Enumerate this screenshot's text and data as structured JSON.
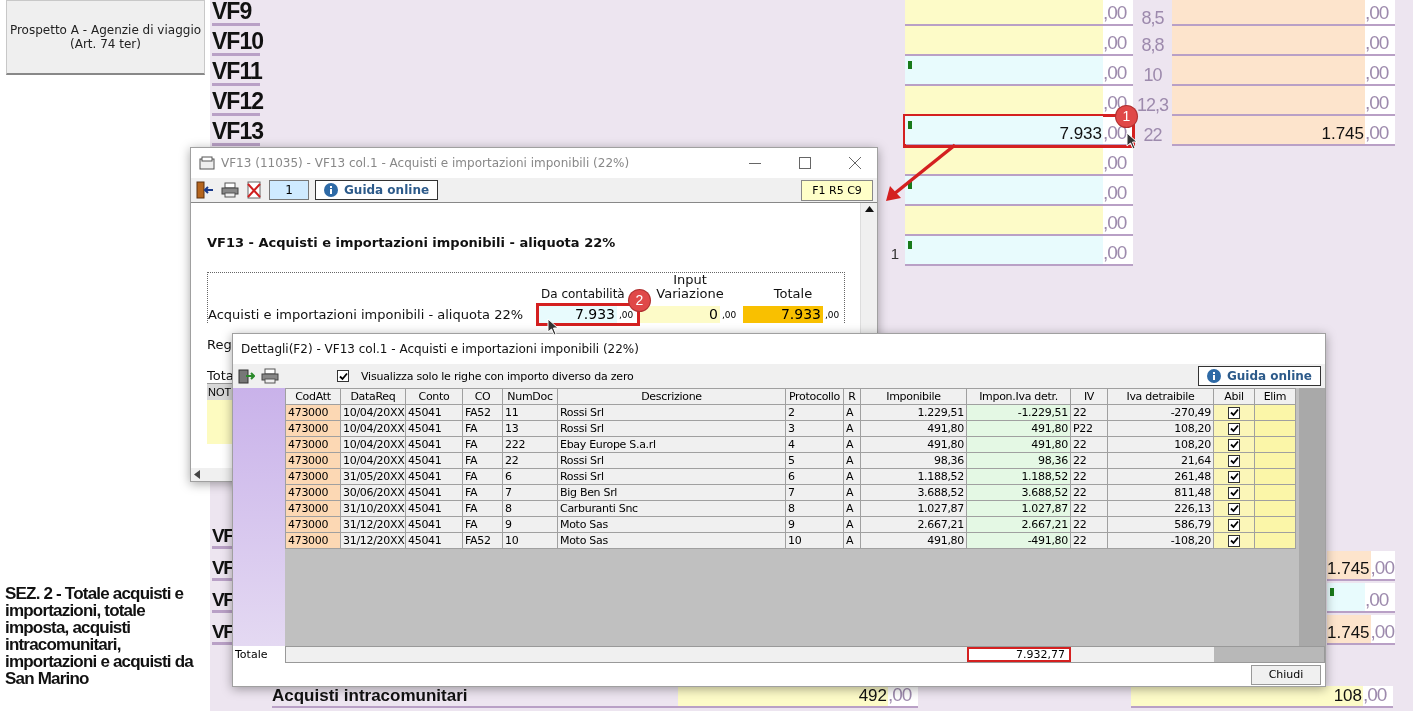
{
  "side_button": {
    "lines": [
      "Prospetto A - Agenzie di viaggio",
      "(Art. 74 ter)"
    ]
  },
  "section_title": "SEZ. 2 - Totale acquisti e importazioni, totale imposta, acquisti intracomunitari, importazioni e acquisti da San Marino",
  "top_rows": [
    {
      "label": "VF9",
      "base": {
        "kind": "input",
        "decimals": ",00"
      },
      "rate": "8,5",
      "tax": {
        "kind": "tax",
        "decimals": ",00"
      }
    },
    {
      "label": "VF10",
      "base": {
        "kind": "input",
        "decimals": ",00"
      },
      "rate": "8,8",
      "tax": {
        "kind": "tax",
        "decimals": ",00"
      }
    },
    {
      "label": "VF11",
      "base": {
        "kind": "calc",
        "decimals": ",00"
      },
      "rate": "10",
      "tax": {
        "kind": "tax",
        "decimals": ",00"
      }
    },
    {
      "label": "VF12",
      "base": {
        "kind": "input",
        "decimals": ",00"
      },
      "rate": "12,3",
      "tax": {
        "kind": "tax",
        "decimals": ",00"
      }
    },
    {
      "label": "VF13",
      "base": {
        "kind": "calc",
        "value": "7.933",
        "decimals": ",00",
        "highlighted": true
      },
      "rate": "22",
      "tax": {
        "kind": "tax",
        "value": "1.745",
        "decimals": ",00"
      }
    },
    {
      "base": {
        "kind": "input",
        "decimals": ",00"
      }
    },
    {
      "base": {
        "kind": "calc",
        "decimals": ",00"
      }
    },
    {
      "base": {
        "kind": "input",
        "decimals": ",00"
      }
    },
    {
      "prefix": "1",
      "base": {
        "kind": "calc",
        "decimals": ",00"
      }
    }
  ],
  "bottom_rows": [
    {
      "label": "VF"
    },
    {
      "label": "VF",
      "tax": {
        "kind": "tax",
        "value": "1.745",
        "decimals": ",00"
      }
    },
    {
      "label": "VF",
      "tax": {
        "kind": "calc",
        "decimals": ",00"
      }
    },
    {
      "label": "VF",
      "tax": {
        "kind": "tax",
        "value": "1.745",
        "decimals": ",00"
      }
    }
  ],
  "intra_row": {
    "label": "Acquisti intracomunitari",
    "base": {
      "kind": "input",
      "value": "492",
      "decimals": ",00"
    },
    "tax": {
      "kind": "input",
      "value": "108",
      "decimals": ",00"
    }
  },
  "dialog_detail": {
    "title": "VF13 (11035) - VF13 col.1 - Acquisti e importazioni imponibili (22%)",
    "page": "1",
    "help": "Guida online",
    "position": "F1 R5 C9",
    "heading": "VF13 - Acquisti e importazioni imponibili - aliquota 22%",
    "columns": [
      "Da  contabilità",
      "Input Variazione",
      "Totale"
    ],
    "row": {
      "label": "Acquisti e importazioni imponibili - aliquota 22%",
      "cells": [
        {
          "kind": "calc",
          "value": "7.933",
          "decimals": ",00",
          "highlighted": true
        },
        {
          "kind": "input",
          "value": "0",
          "decimals": ",00"
        },
        {
          "kind": "total",
          "value": "7.933",
          "decimals": ",00"
        }
      ]
    },
    "cut_labels": [
      "Reg",
      "Tota",
      "NOT"
    ]
  },
  "dialog_list": {
    "title": "Dettagli(F2) - VF13 col.1 - Acquisti e importazioni imponibili (22%)",
    "filter": {
      "label": "Visualizza solo le righe con importo diverso da zero",
      "checked": true
    },
    "help": "Guida online",
    "columns": [
      "CodAtt",
      "DataReq",
      "Conto",
      "CO",
      "NumDoc",
      "Descrizione",
      "Protocollo",
      "R",
      "Imponibile",
      "Impon.Iva detr.",
      "IV",
      "Iva detraibile",
      "Abil",
      "Elim"
    ],
    "rows": [
      {
        "cells": [
          "473000",
          "10/04/20XX",
          "45041",
          "FA52",
          "11",
          "Rossi Srl",
          "2",
          "A",
          "1.229,51",
          "-1.229,51",
          "22",
          "-270,49"
        ],
        "abil": true
      },
      {
        "cells": [
          "473000",
          "10/04/20XX",
          "45041",
          "FA",
          "13",
          "Rossi Srl",
          "3",
          "A",
          "491,80",
          "491,80",
          "P22",
          "108,20"
        ],
        "abil": true
      },
      {
        "cells": [
          "473000",
          "10/04/20XX",
          "45041",
          "FA",
          "222",
          "Ebay Europe S.a.rl",
          "4",
          "A",
          "491,80",
          "491,80",
          "22",
          "108,20"
        ],
        "abil": true
      },
      {
        "cells": [
          "473000",
          "10/04/20XX",
          "45041",
          "FA",
          "22",
          "Rossi Srl",
          "5",
          "A",
          "98,36",
          "98,36",
          "22",
          "21,64"
        ],
        "abil": true
      },
      {
        "cells": [
          "473000",
          "31/05/20XX",
          "45041",
          "FA",
          "6",
          "Rossi Srl",
          "6",
          "A",
          "1.188,52",
          "1.188,52",
          "22",
          "261,48"
        ],
        "abil": true
      },
      {
        "cells": [
          "473000",
          "30/06/20XX",
          "45041",
          "FA",
          "7",
          "Big Ben Srl",
          "7",
          "A",
          "3.688,52",
          "3.688,52",
          "22",
          "811,48"
        ],
        "abil": true
      },
      {
        "cells": [
          "473000",
          "31/10/20XX",
          "45041",
          "FA",
          "8",
          "Carburanti Snc",
          "8",
          "A",
          "1.027,87",
          "1.027,87",
          "22",
          "226,13"
        ],
        "abil": true
      },
      {
        "cells": [
          "473000",
          "31/12/20XX",
          "45041",
          "FA",
          "9",
          "Moto Sas",
          "9",
          "A",
          "2.667,21",
          "2.667,21",
          "22",
          "586,79"
        ],
        "abil": true
      },
      {
        "cells": [
          "473000",
          "31/12/20XX",
          "45041",
          "FA52",
          "10",
          "Moto Sas",
          "10",
          "A",
          "491,80",
          "-491,80",
          "22",
          "-108,20"
        ],
        "abil": true
      }
    ],
    "total_label": "Totale",
    "total": "7.932,77",
    "close": "Chiudi"
  },
  "annotations": [
    {
      "label": "1"
    },
    {
      "label": "2"
    }
  ]
}
